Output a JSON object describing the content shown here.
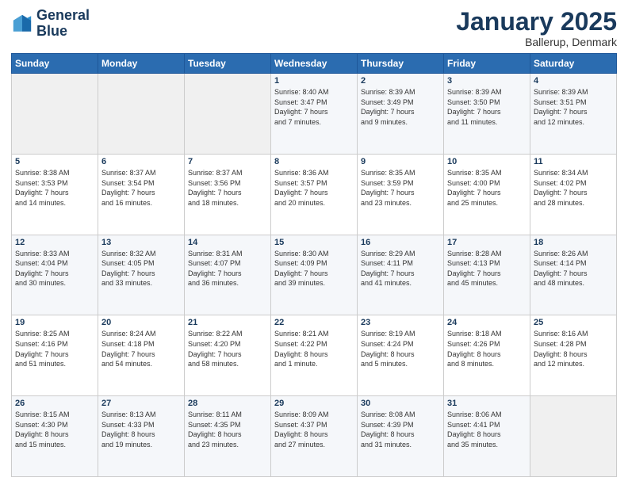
{
  "logo": {
    "line1": "General",
    "line2": "Blue"
  },
  "header": {
    "title": "January 2025",
    "location": "Ballerup, Denmark"
  },
  "weekdays": [
    "Sunday",
    "Monday",
    "Tuesday",
    "Wednesday",
    "Thursday",
    "Friday",
    "Saturday"
  ],
  "weeks": [
    [
      {
        "day": "",
        "content": ""
      },
      {
        "day": "",
        "content": ""
      },
      {
        "day": "",
        "content": ""
      },
      {
        "day": "1",
        "content": "Sunrise: 8:40 AM\nSunset: 3:47 PM\nDaylight: 7 hours\nand 7 minutes."
      },
      {
        "day": "2",
        "content": "Sunrise: 8:39 AM\nSunset: 3:49 PM\nDaylight: 7 hours\nand 9 minutes."
      },
      {
        "day": "3",
        "content": "Sunrise: 8:39 AM\nSunset: 3:50 PM\nDaylight: 7 hours\nand 11 minutes."
      },
      {
        "day": "4",
        "content": "Sunrise: 8:39 AM\nSunset: 3:51 PM\nDaylight: 7 hours\nand 12 minutes."
      }
    ],
    [
      {
        "day": "5",
        "content": "Sunrise: 8:38 AM\nSunset: 3:53 PM\nDaylight: 7 hours\nand 14 minutes."
      },
      {
        "day": "6",
        "content": "Sunrise: 8:37 AM\nSunset: 3:54 PM\nDaylight: 7 hours\nand 16 minutes."
      },
      {
        "day": "7",
        "content": "Sunrise: 8:37 AM\nSunset: 3:56 PM\nDaylight: 7 hours\nand 18 minutes."
      },
      {
        "day": "8",
        "content": "Sunrise: 8:36 AM\nSunset: 3:57 PM\nDaylight: 7 hours\nand 20 minutes."
      },
      {
        "day": "9",
        "content": "Sunrise: 8:35 AM\nSunset: 3:59 PM\nDaylight: 7 hours\nand 23 minutes."
      },
      {
        "day": "10",
        "content": "Sunrise: 8:35 AM\nSunset: 4:00 PM\nDaylight: 7 hours\nand 25 minutes."
      },
      {
        "day": "11",
        "content": "Sunrise: 8:34 AM\nSunset: 4:02 PM\nDaylight: 7 hours\nand 28 minutes."
      }
    ],
    [
      {
        "day": "12",
        "content": "Sunrise: 8:33 AM\nSunset: 4:04 PM\nDaylight: 7 hours\nand 30 minutes."
      },
      {
        "day": "13",
        "content": "Sunrise: 8:32 AM\nSunset: 4:05 PM\nDaylight: 7 hours\nand 33 minutes."
      },
      {
        "day": "14",
        "content": "Sunrise: 8:31 AM\nSunset: 4:07 PM\nDaylight: 7 hours\nand 36 minutes."
      },
      {
        "day": "15",
        "content": "Sunrise: 8:30 AM\nSunset: 4:09 PM\nDaylight: 7 hours\nand 39 minutes."
      },
      {
        "day": "16",
        "content": "Sunrise: 8:29 AM\nSunset: 4:11 PM\nDaylight: 7 hours\nand 41 minutes."
      },
      {
        "day": "17",
        "content": "Sunrise: 8:28 AM\nSunset: 4:13 PM\nDaylight: 7 hours\nand 45 minutes."
      },
      {
        "day": "18",
        "content": "Sunrise: 8:26 AM\nSunset: 4:14 PM\nDaylight: 7 hours\nand 48 minutes."
      }
    ],
    [
      {
        "day": "19",
        "content": "Sunrise: 8:25 AM\nSunset: 4:16 PM\nDaylight: 7 hours\nand 51 minutes."
      },
      {
        "day": "20",
        "content": "Sunrise: 8:24 AM\nSunset: 4:18 PM\nDaylight: 7 hours\nand 54 minutes."
      },
      {
        "day": "21",
        "content": "Sunrise: 8:22 AM\nSunset: 4:20 PM\nDaylight: 7 hours\nand 58 minutes."
      },
      {
        "day": "22",
        "content": "Sunrise: 8:21 AM\nSunset: 4:22 PM\nDaylight: 8 hours\nand 1 minute."
      },
      {
        "day": "23",
        "content": "Sunrise: 8:19 AM\nSunset: 4:24 PM\nDaylight: 8 hours\nand 5 minutes."
      },
      {
        "day": "24",
        "content": "Sunrise: 8:18 AM\nSunset: 4:26 PM\nDaylight: 8 hours\nand 8 minutes."
      },
      {
        "day": "25",
        "content": "Sunrise: 8:16 AM\nSunset: 4:28 PM\nDaylight: 8 hours\nand 12 minutes."
      }
    ],
    [
      {
        "day": "26",
        "content": "Sunrise: 8:15 AM\nSunset: 4:30 PM\nDaylight: 8 hours\nand 15 minutes."
      },
      {
        "day": "27",
        "content": "Sunrise: 8:13 AM\nSunset: 4:33 PM\nDaylight: 8 hours\nand 19 minutes."
      },
      {
        "day": "28",
        "content": "Sunrise: 8:11 AM\nSunset: 4:35 PM\nDaylight: 8 hours\nand 23 minutes."
      },
      {
        "day": "29",
        "content": "Sunrise: 8:09 AM\nSunset: 4:37 PM\nDaylight: 8 hours\nand 27 minutes."
      },
      {
        "day": "30",
        "content": "Sunrise: 8:08 AM\nSunset: 4:39 PM\nDaylight: 8 hours\nand 31 minutes."
      },
      {
        "day": "31",
        "content": "Sunrise: 8:06 AM\nSunset: 4:41 PM\nDaylight: 8 hours\nand 35 minutes."
      },
      {
        "day": "",
        "content": ""
      }
    ]
  ]
}
